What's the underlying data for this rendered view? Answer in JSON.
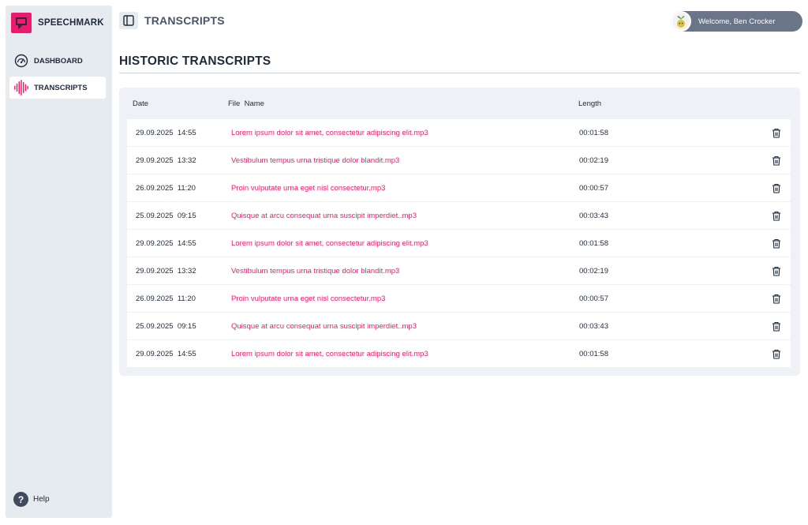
{
  "brand": {
    "name": "SPEECHMARK",
    "accent": "#ee1a6e"
  },
  "sidebar": {
    "items": [
      {
        "label": "DASHBOARD",
        "icon": "speedometer-icon",
        "active": false
      },
      {
        "label": "TRANSCRIPTS",
        "icon": "waveform-icon",
        "active": true
      }
    ],
    "help_label": "Help"
  },
  "header": {
    "title": "TRANSCRIPTS",
    "user_greeting": "Welcome, Ben Crocker"
  },
  "main": {
    "heading": "HISTORIC TRANSCRIPTS",
    "columns": {
      "date": "Date",
      "file": "File  Name",
      "length": "Length"
    },
    "rows": [
      {
        "date": "29.09.2025  14:55",
        "file": "Lorem ipsum dolor sit amet, consectetur adipiscing elit.mp3",
        "length": "00:01:58"
      },
      {
        "date": "29.09.2025  13:32",
        "file": "Vestibulum tempus urna tristique dolor blandit.mp3",
        "length": "00:02:19"
      },
      {
        "date": "26.09.2025  11:20",
        "file": "Proin vulputate urna eget nisl consectetur.mp3",
        "length": "00:00:57"
      },
      {
        "date": "25.09.2025  09:15",
        "file": "Quisque at arcu consequat urna suscipit imperdiet..mp3",
        "length": "00:03:43"
      },
      {
        "date": "29.09.2025  14:55",
        "file": "Lorem ipsum dolor sit amet, consectetur adipiscing elit.mp3",
        "length": "00:01:58"
      },
      {
        "date": "29.09.2025  13:32",
        "file": "Vestibulum tempus urna tristique dolor blandit.mp3",
        "length": "00:02:19"
      },
      {
        "date": "26.09.2025  11:20",
        "file": "Proin vulputate urna eget nisl consectetur.mp3",
        "length": "00:00:57"
      },
      {
        "date": "25.09.2025  09:15",
        "file": "Quisque at arcu consequat urna suscipit imperdiet..mp3",
        "length": "00:03:43"
      },
      {
        "date": "29.09.2025  14:55",
        "file": "Lorem ipsum dolor sit amet, consectetur adipiscing elit.mp3",
        "length": "00:01:58"
      }
    ]
  }
}
